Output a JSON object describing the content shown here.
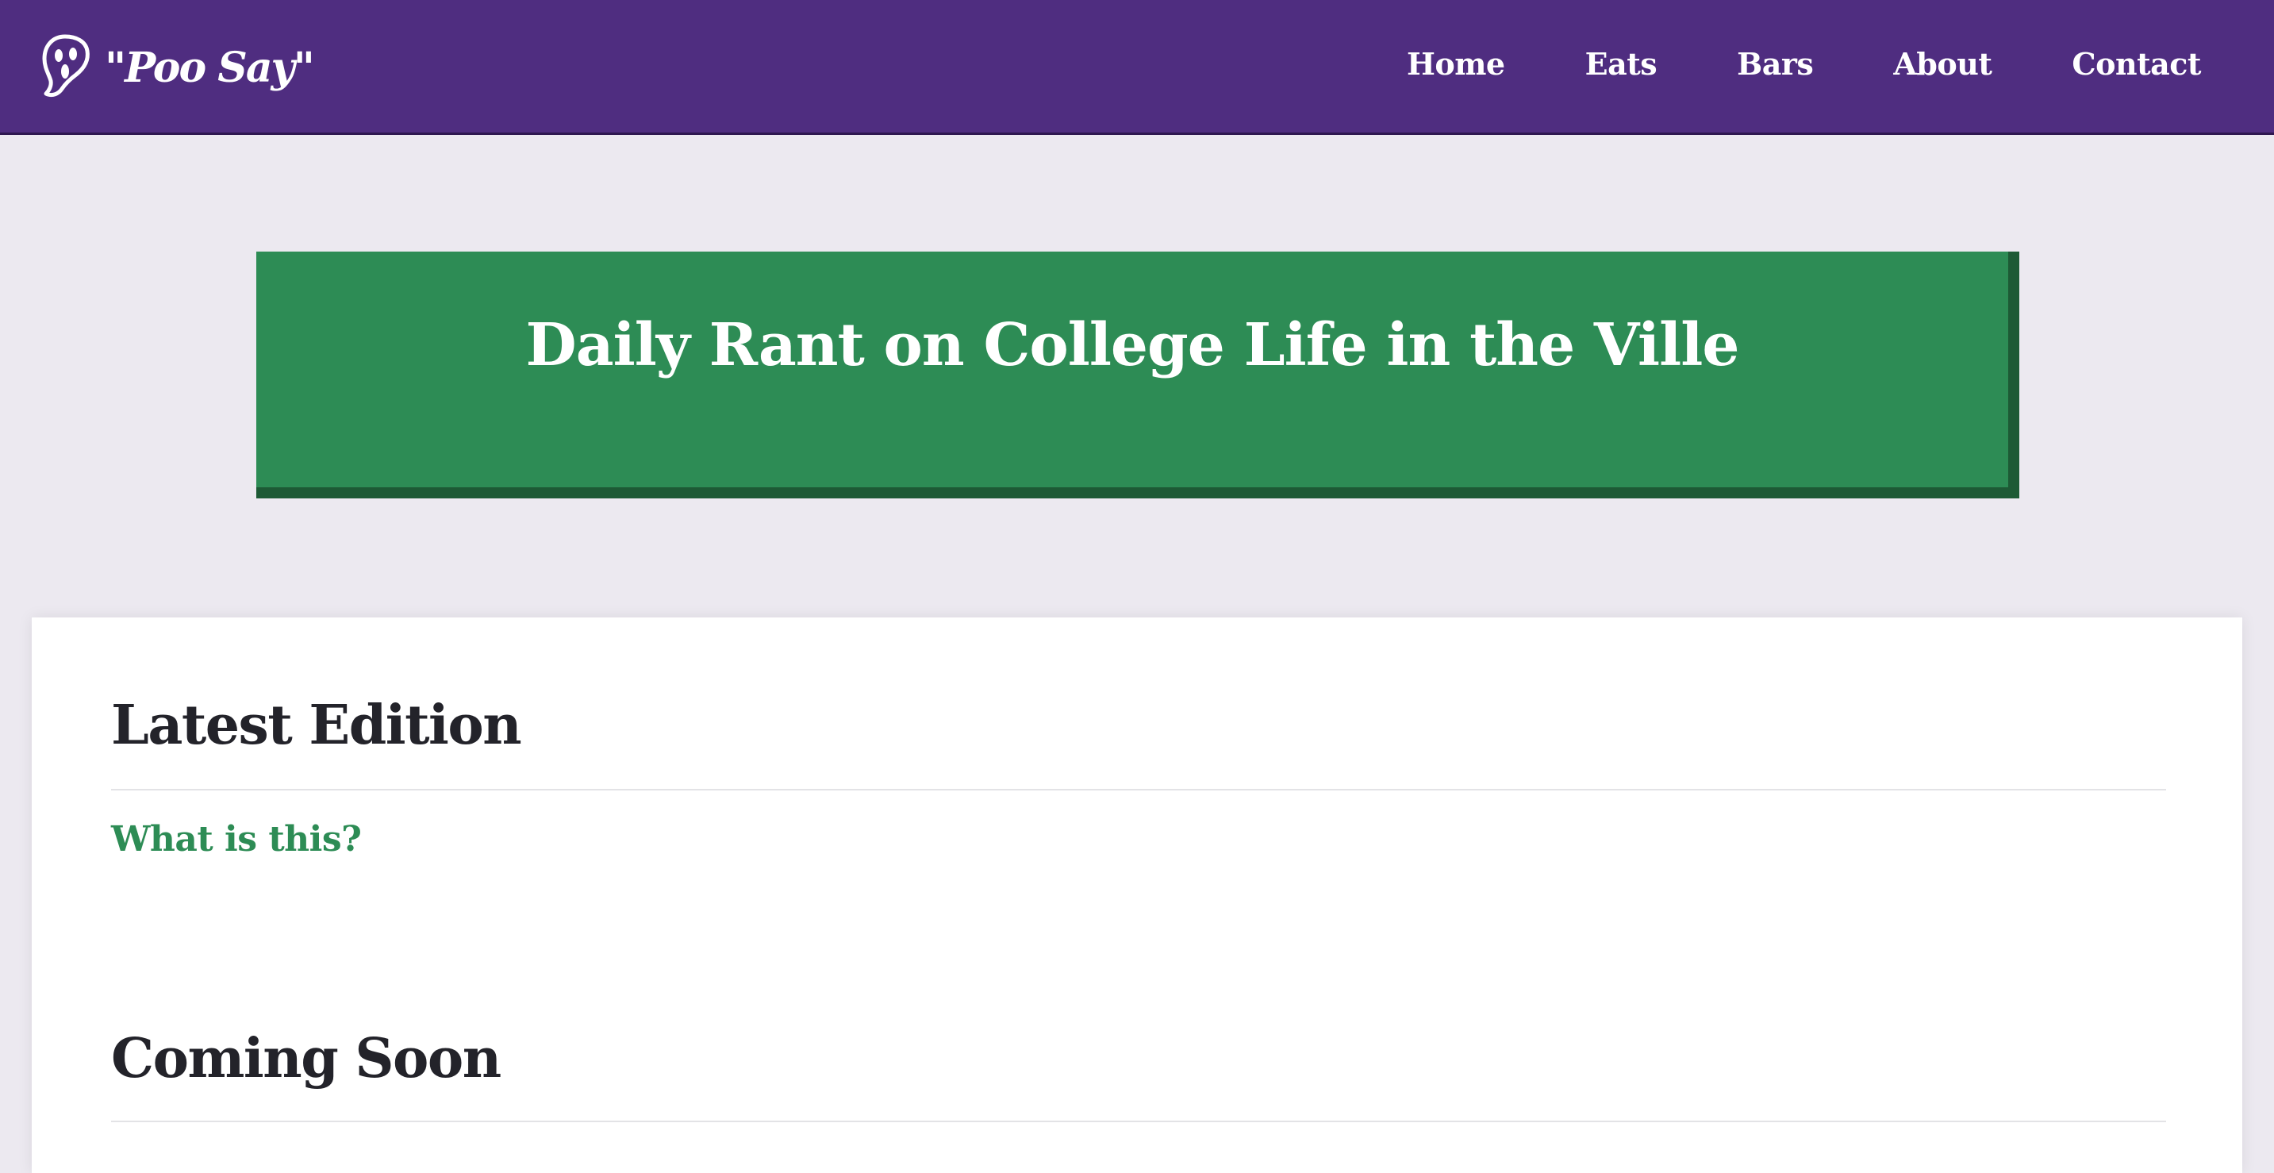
{
  "navbar": {
    "brand": "\"Poo Say\"",
    "logo_icon": "ghost-face-icon",
    "links": [
      "Home",
      "Eats",
      "Bars",
      "About",
      "Contact"
    ]
  },
  "hero": {
    "title": "Daily Rant on College Life in the Ville"
  },
  "content": {
    "latest_heading": "Latest Edition",
    "latest_link": "What is this?",
    "coming_soon_heading": "Coming Soon"
  },
  "colors": {
    "navbar_bg": "#4f2d80",
    "page_bg": "#ece9f0",
    "hero_bg": "#2d8c55",
    "hero_shadow": "#1d5a35",
    "link_green": "#2d8c55",
    "heading_text": "#23232a"
  }
}
